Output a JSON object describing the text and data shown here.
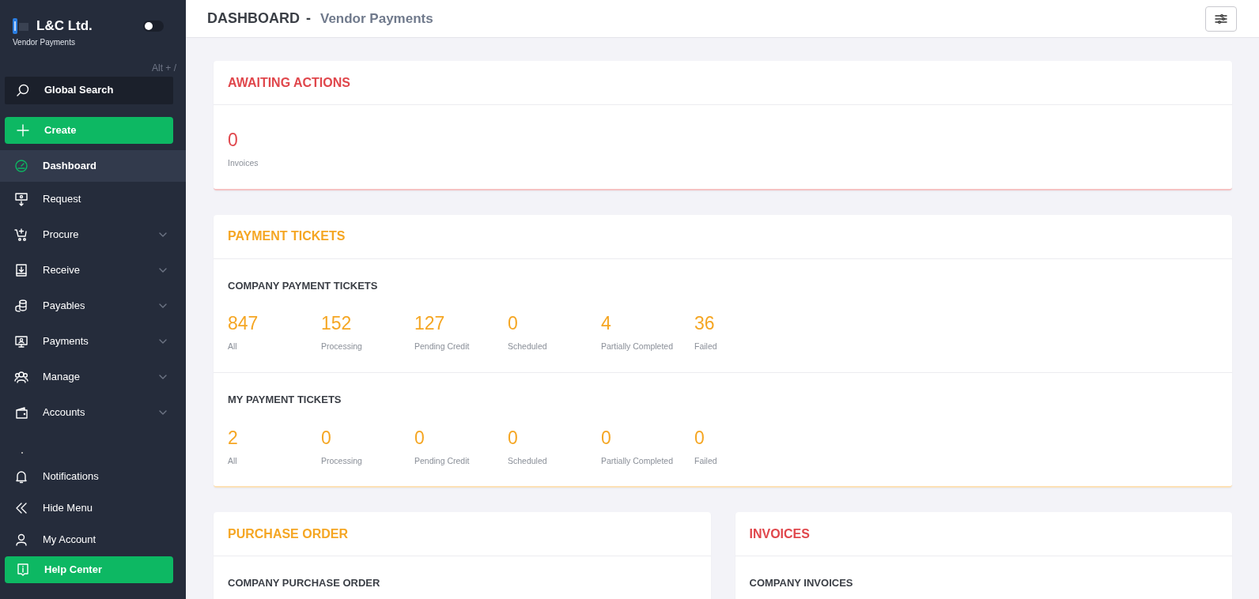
{
  "sidebar": {
    "brand": {
      "name": "L&C Ltd.",
      "subtitle": "Vendor Payments"
    },
    "theme_toggle": {
      "on": false
    },
    "search": {
      "shortcut": "Alt + /",
      "label": "Global Search"
    },
    "create_button": "Create",
    "nav_items": [
      {
        "label": "Dashboard",
        "selected": true,
        "expandable": false
      },
      {
        "label": "Request",
        "selected": false,
        "expandable": false
      },
      {
        "label": "Procure",
        "selected": false,
        "expandable": true
      },
      {
        "label": "Receive",
        "selected": false,
        "expandable": true
      },
      {
        "label": "Payables",
        "selected": false,
        "expandable": true
      },
      {
        "label": "Payments",
        "selected": false,
        "expandable": true
      },
      {
        "label": "Manage",
        "selected": false,
        "expandable": true
      },
      {
        "label": "Accounts",
        "selected": false,
        "expandable": true
      }
    ],
    "footer_items": [
      {
        "label": "Notifications"
      },
      {
        "label": "Hide Menu"
      },
      {
        "label": "My Account"
      }
    ],
    "help_button": "Help Center"
  },
  "header": {
    "title": "DASHBOARD",
    "separator": "-",
    "subtitle": "Vendor Payments"
  },
  "cards": [
    {
      "title": "AWAITING ACTIONS",
      "color": "#e0474c",
      "sections": [
        {
          "stats": [
            {
              "value": "0",
              "label": "Invoices"
            }
          ]
        }
      ]
    },
    {
      "title": "PAYMENT TICKETS",
      "color": "#f5a623",
      "sections": [
        {
          "heading": "COMPANY PAYMENT TICKETS",
          "stats": [
            {
              "value": "847",
              "label": "All"
            },
            {
              "value": "152",
              "label": "Processing"
            },
            {
              "value": "127",
              "label": "Pending Credit"
            },
            {
              "value": "0",
              "label": "Scheduled"
            },
            {
              "value": "4",
              "label": "Partially Completed"
            },
            {
              "value": "36",
              "label": "Failed"
            }
          ]
        },
        {
          "heading": "MY PAYMENT TICKETS",
          "stats": [
            {
              "value": "2",
              "label": "All"
            },
            {
              "value": "0",
              "label": "Processing"
            },
            {
              "value": "0",
              "label": "Pending Credit"
            },
            {
              "value": "0",
              "label": "Scheduled"
            },
            {
              "value": "0",
              "label": "Partially Completed"
            },
            {
              "value": "0",
              "label": "Failed"
            }
          ]
        }
      ]
    }
  ],
  "card_row": [
    {
      "title": "PURCHASE ORDER",
      "color": "#f5a623",
      "sections": [
        {
          "heading": "COMPANY PURCHASE ORDER"
        }
      ]
    },
    {
      "title": "INVOICES",
      "color": "#e0474c",
      "sections": [
        {
          "heading": "COMPANY INVOICES"
        }
      ]
    }
  ]
}
